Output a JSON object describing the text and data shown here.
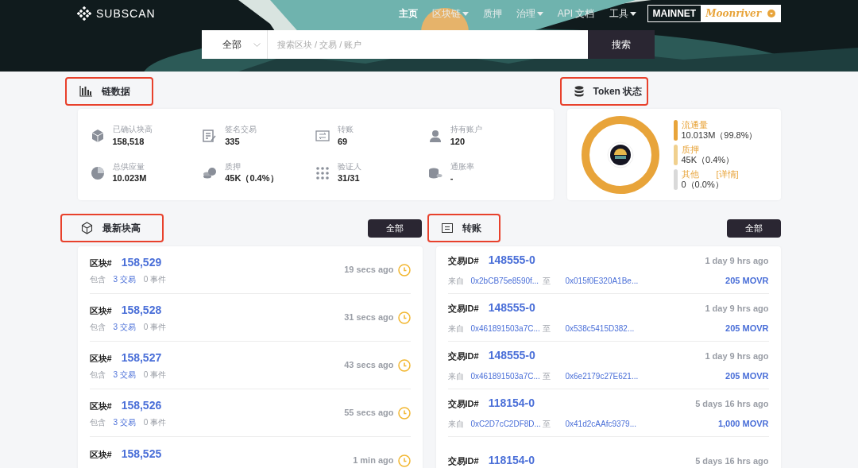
{
  "header": {
    "logo": "SUBSCAN",
    "nav": [
      {
        "label": "主页",
        "selected": true,
        "dropdown": false
      },
      {
        "label": "区块链",
        "selected": false,
        "dropdown": true
      },
      {
        "label": "质押",
        "selected": false,
        "dropdown": false
      },
      {
        "label": "治理",
        "selected": false,
        "dropdown": true
      },
      {
        "label": "API 文档",
        "selected": false,
        "dropdown": false
      },
      {
        "label": "工具",
        "selected": false,
        "dropdown": true
      }
    ],
    "network": {
      "label": "MAINNET",
      "chain": "Moonriver"
    },
    "search": {
      "scope": "全部",
      "placeholder": "搜索区块 / 交易 / 账户",
      "button": "搜索"
    }
  },
  "chain_data": {
    "title": "链数据",
    "stats": [
      {
        "kind": "cube",
        "label": "已确认块高",
        "value": "158,518"
      },
      {
        "kind": "sign",
        "label": "签名交易",
        "value": "335"
      },
      {
        "kind": "transfer",
        "label": "转账",
        "value": "69"
      },
      {
        "kind": "user",
        "label": "持有账户",
        "value": "120"
      },
      {
        "kind": "pie",
        "label": "总供应量",
        "value": "10.023M"
      },
      {
        "kind": "stake",
        "label": "质押",
        "value": "45K（0.4%）"
      },
      {
        "kind": "validators",
        "label": "验证人",
        "value": "31/31"
      },
      {
        "kind": "coins",
        "label": "通胀率",
        "value": "-"
      }
    ]
  },
  "token": {
    "title": "Token 状态",
    "legend": [
      {
        "label": "流通量",
        "value": "10.013M（99.8%）",
        "color": "#e8a43a"
      },
      {
        "label": "质押",
        "value": "45K（0.4%）",
        "color": "#f0d08e"
      },
      {
        "label": "其他",
        "value": "0（0.0%）",
        "color": "#d9d9d9",
        "link": "[详情]"
      }
    ]
  },
  "blocks": {
    "title": "最新块高",
    "all_button": "全部",
    "rows": [
      {
        "label": "区块#",
        "number": "158,529",
        "contains": "包含",
        "extrinsics": "3 交易",
        "events": "0 事件",
        "time": "19 secs ago"
      },
      {
        "label": "区块#",
        "number": "158,528",
        "contains": "包含",
        "extrinsics": "3 交易",
        "events": "0 事件",
        "time": "31 secs ago"
      },
      {
        "label": "区块#",
        "number": "158,527",
        "contains": "包含",
        "extrinsics": "3 交易",
        "events": "0 事件",
        "time": "43 secs ago"
      },
      {
        "label": "区块#",
        "number": "158,526",
        "contains": "包含",
        "extrinsics": "3 交易",
        "events": "0 事件",
        "time": "55 secs ago"
      },
      {
        "label": "区块#",
        "number": "158,525",
        "time": "1 min ago"
      }
    ]
  },
  "transfers": {
    "title": "转账",
    "all_button": "全部",
    "rows": [
      {
        "label": "交易ID#",
        "id": "148555-0",
        "time": "1 day 9 hrs ago",
        "from_label": "来自",
        "from": "0x2bCB75e8590f...",
        "to_label": "至",
        "to": "0x015f0E320A1Be...",
        "amount": "205 MOVR"
      },
      {
        "label": "交易ID#",
        "id": "148555-0",
        "time": "1 day 9 hrs ago",
        "from_label": "来自",
        "from": "0x461891503a7C...",
        "to_label": "至",
        "to": "0x538c5415D382...",
        "amount": "205 MOVR"
      },
      {
        "label": "交易ID#",
        "id": "148555-0",
        "time": "1 day 9 hrs ago",
        "from_label": "来自",
        "from": "0x461891503a7C...",
        "to_label": "至",
        "to": "0x6e2179c27E621...",
        "amount": "205 MOVR"
      },
      {
        "label": "交易ID#",
        "id": "118154-0",
        "time": "5 days 16 hrs ago",
        "from_label": "来自",
        "from": "0xC2D7cC2DF8D...",
        "to_label": "至",
        "to": "0x41d2cAAfc9379...",
        "amount": "1,000 MOVR"
      },
      {
        "label": "交易ID#",
        "id": "118154-0",
        "time": "5 days 16 hrs ago"
      }
    ]
  }
}
